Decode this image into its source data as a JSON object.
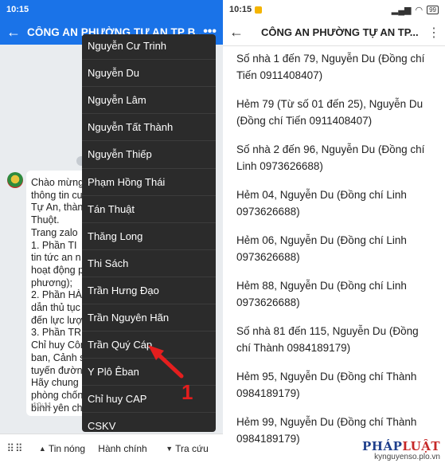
{
  "left": {
    "status": {
      "time": "10:15",
      "battery": "99"
    },
    "header": {
      "title": "CÔNG AN PHƯỜNG TỰ AN TP B...",
      "back_icon": "back-arrow-icon",
      "more_icon": "more-icon"
    },
    "message": {
      "lines": [
        "Chào mừng",
        "thông tin cu",
        "Tự An, thàn",
        "Thuột.",
        "  Trang zalo",
        " 1. Phần TI",
        "tin tức an n",
        "hoạt động p",
        "phương);",
        " 2. Phần HÀ",
        "dẫn thủ tục",
        "đến lực lượ",
        " 3. Phần TR",
        "Chỉ huy Côn",
        "ban, Cảnh s",
        "tuyến đườn",
        "Hãy chung",
        "phòng chốn",
        "bình yên ch"
      ],
      "time": "10:11"
    },
    "menu": {
      "items": [
        "Nguyễn Cư Trinh",
        "Nguyễn Du",
        "Nguyễn Lâm",
        "Nguyễn Tất Thành",
        "Nguyễn Thiếp",
        "Phạm Hồng Thái",
        "Tán Thuật",
        "Thăng Long",
        "Thi Sách",
        "Trần Hưng Đạo",
        "Trần Nguyên Hãn",
        "Trần Quý Cáp",
        "Y Plô Êban",
        "Chỉ huy CAP",
        "CSKV"
      ]
    },
    "callout_number": "1",
    "bottom_bar": {
      "keyboard_icon": "keyboard-icon",
      "tabs": [
        "Tin nóng",
        "Hành chính",
        "Tra cứu"
      ]
    }
  },
  "right": {
    "status": {
      "time": "10:15",
      "battery": "99"
    },
    "header": {
      "title": "CÔNG AN PHƯỜNG TỰ AN TP...",
      "back_icon": "back-arrow-icon",
      "more_icon": "more-icon"
    },
    "entries": [
      "Số nhà 1 đến 79, Nguyễn Du (Đồng chí Tiến 0911408407)",
      "Hẻm 79 (Từ số 01 đến 25), Nguyễn Du (Đồng chí Tiến 0911408407)",
      "Số nhà 2 đến 96, Nguyễn Du (Đồng chí Linh 0973626688)",
      "Hẻm 04, Nguyễn Du (Đồng chí Linh 0973626688)",
      "Hẻm 06, Nguyễn Du (Đồng chí Linh 0973626688)",
      "Hẻm 88, Nguyễn Du (Đồng chí Linh 0973626688)",
      "Số nhà 81 đến 115, Nguyễn Du (Đồng chí Thành 0984189179)",
      "Hẻm 95, Nguyễn Du (Đồng chí Thành 0984189179)",
      "Hẻm 99, Nguyễn Du (Đồng chí Thành 0984189179)"
    ]
  },
  "watermark": {
    "logo_a": "PHÁP",
    "logo_b": "LUẬT",
    "site": "kynguyenso.plo.vn"
  },
  "colors": {
    "brand_blue": "#1a73e8",
    "menu_bg": "#2b2b2b",
    "callout_red": "#e41e1e"
  }
}
